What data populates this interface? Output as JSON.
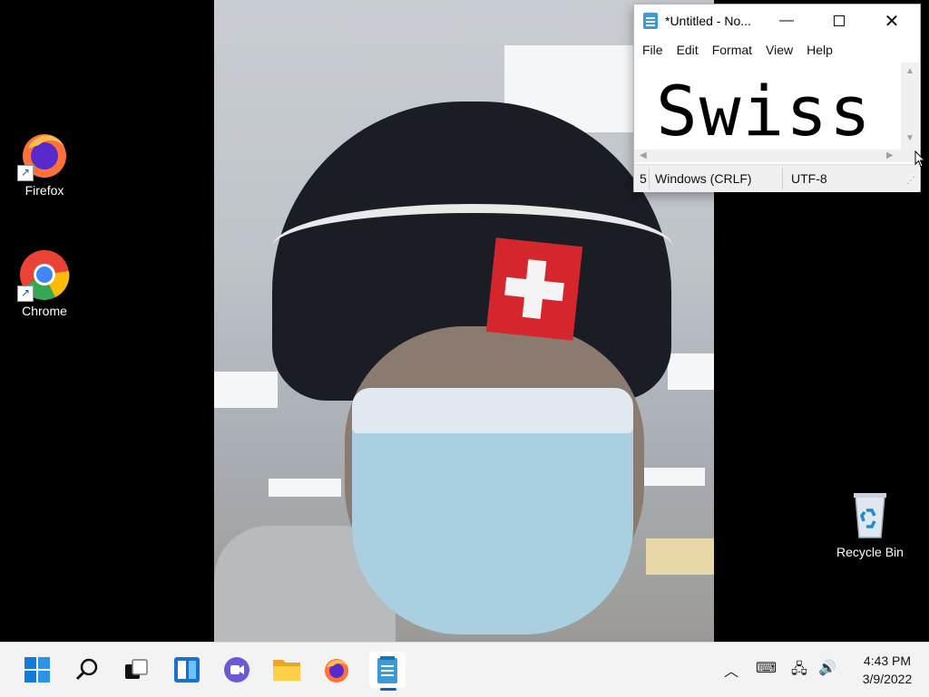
{
  "desktop": {
    "icons": [
      {
        "label": "Firefox",
        "icon": "firefox-icon"
      },
      {
        "label": "Chrome",
        "icon": "chrome-icon"
      },
      {
        "label": "Recycle Bin",
        "icon": "recycle-bin-icon"
      }
    ]
  },
  "notepad": {
    "title": "*Untitled - No...",
    "menu": [
      "File",
      "Edit",
      "Format",
      "View",
      "Help"
    ],
    "content": "Swiss",
    "status": {
      "position": "5",
      "line_ending": "Windows (CRLF)",
      "encoding": "UTF-8"
    }
  },
  "taskbar": {
    "apps": [
      "start-icon",
      "search-icon",
      "task-view-icon",
      "widgets-icon",
      "chat-icon",
      "file-explorer-icon",
      "firefox-icon",
      "notepad-icon"
    ],
    "clock": {
      "time": "4:43 PM",
      "date": "3/9/2022"
    }
  },
  "colors": {
    "accent": "#0a64c8",
    "flag_red": "#d5262d"
  }
}
